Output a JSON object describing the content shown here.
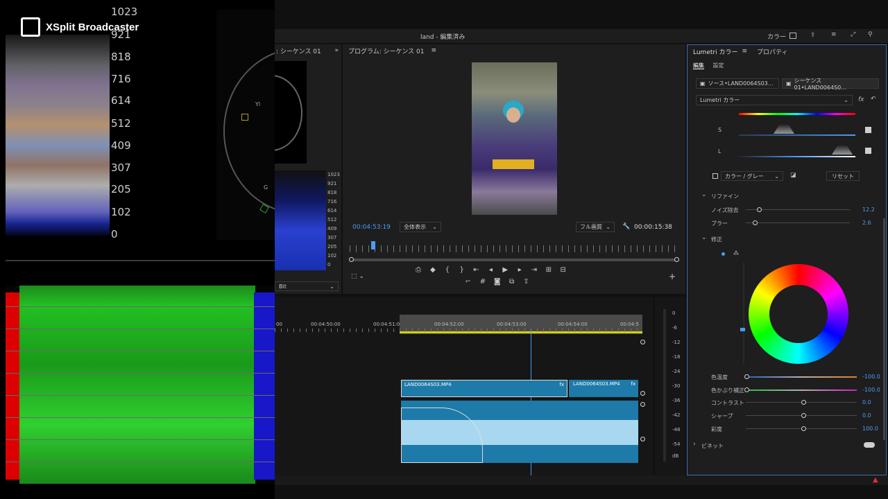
{
  "overlay": {
    "brand": "XSplit Broadcaster"
  },
  "scope": {
    "ticks": [
      "1023",
      "921",
      "818",
      "716",
      "614",
      "512",
      "409",
      "307",
      "205",
      "102",
      "0"
    ],
    "mini_ticks": [
      "1023",
      "921",
      "818",
      "716",
      "614",
      "512",
      "409",
      "307",
      "205",
      "102",
      "0"
    ],
    "partial_tab": ": シーケンス 01",
    "bit_label": "Bit",
    "vector_label_yl": "Yl",
    "vector_label_g": "G"
  },
  "window": {
    "title": "land - 編集済み",
    "workspace": "カラー"
  },
  "program": {
    "title": "プログラム: シーケンス 01",
    "timecode": "00:04:53:19",
    "zoom": "全体表示",
    "quality": "フル画質",
    "duration": "00:00:15:38"
  },
  "timeline": {
    "times": [
      "00",
      "00:04:50:00",
      "00:04:51:00",
      "00:04:52:00",
      "00:04:53:00",
      "00:04:54:00",
      "00:04:5"
    ],
    "clip1": "LAND0064S03.MP4",
    "clip2": "LAND0064S03.MP4",
    "fx": "fx",
    "meter": [
      "0",
      "-6",
      "-12",
      "-18",
      "-24",
      "-30",
      "-36",
      "-42",
      "-48",
      "-54",
      "dB"
    ]
  },
  "lumetri": {
    "tab1": "Lumetri カラー",
    "tab2": "プロパティ",
    "sub_edit": "編集",
    "sub_settings": "設定",
    "source": "ソース•LAND0064S03...",
    "sequence": "シーケンス 01•LAND0064S0...",
    "effect": "Lumetri カラー",
    "fx": "fx",
    "s_label": "S",
    "l_label": "L",
    "color_gray": "カラー / グレー",
    "reset": "リセット",
    "refine": "リファイン",
    "noise": "ノイズ除去",
    "noise_val": "12.2",
    "blur": "ブラー",
    "blur_val": "2.6",
    "correction": "修正",
    "temp": "色温度",
    "temp_val": "-100.0",
    "tint": "色かぶり補正",
    "tint_val": "-100.0",
    "contrast": "コントラスト",
    "contrast_val": "0.0",
    "sharp": "シャープ",
    "sharp_val": "0.0",
    "sat": "彩度",
    "sat_val": "100.0",
    "vignette": "ビネット"
  }
}
